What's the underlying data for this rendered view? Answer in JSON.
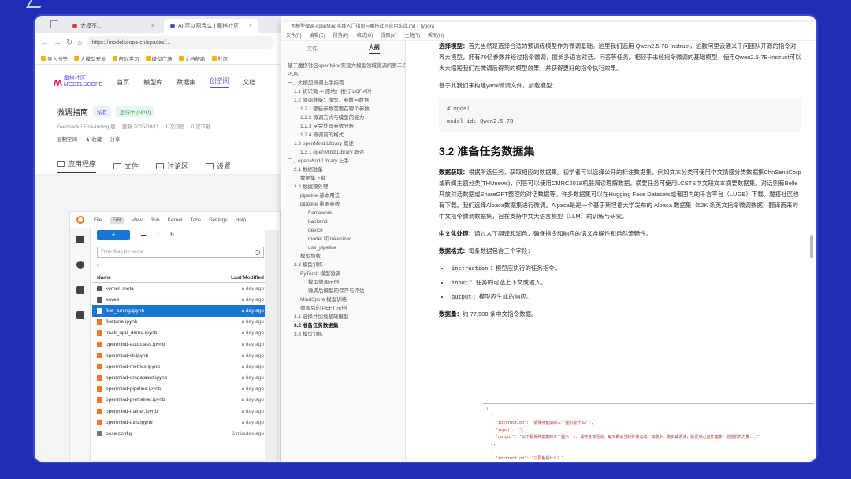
{
  "browser": {
    "tabs": [
      {
        "label": "大模不..."
      },
      {
        "label": "AI 可以帮我么 | 魔搭社区"
      }
    ],
    "url": "https://modelscope.cn/spaces/...",
    "bookmarks": [
      "导入书签",
      "大模型开发",
      "帮你学习",
      "模型广场",
      "文档帮助",
      "社区",
      "开发者"
    ],
    "site": {
      "logo_text": "魔搭社区\nMODELSCOPE",
      "nav": [
        "首页",
        "模型库",
        "数据集",
        "创空间",
        "文档"
      ],
      "active_nav": "创空间"
    },
    "space": {
      "title": "微调指南",
      "tag": "私有",
      "status": "运行中 (NPU)",
      "meta": [
        "Feedback / Fine-tuning 版",
        "更新 2025/09/11",
        "1 次浏览",
        "0 次下载"
      ],
      "actions": [
        "复制空间",
        "★ 收藏",
        "分享"
      ],
      "tabs": [
        "应用程序",
        "文件",
        "讨论区",
        "设置"
      ],
      "active_tab": "应用程序"
    },
    "jupyter": {
      "menu": [
        "File",
        "Edit",
        "View",
        "Run",
        "Kernel",
        "Tabs",
        "Settings",
        "Help"
      ],
      "active_menu": "Edit",
      "filter_placeholder": "Filter files by name",
      "crumb": "/",
      "col_name": "Name",
      "col_modified": "Last Modified",
      "files": [
        {
          "name": "kernel_meta",
          "type": "folder",
          "modified": "a day ago"
        },
        {
          "name": "saves",
          "type": "folder",
          "modified": "a day ago"
        },
        {
          "name": "fine_tuning.ipynb",
          "type": "nb",
          "modified": "a day ago",
          "selected": true
        },
        {
          "name": "finetune.ipynb",
          "type": "nb",
          "modified": "a day ago"
        },
        {
          "name": "multi_npu_demo.ipynb",
          "type": "nb",
          "modified": "a day ago"
        },
        {
          "name": "openmind-autoclass.ipynb",
          "type": "nb",
          "modified": "a day ago"
        },
        {
          "name": "openmind-cli.ipynb",
          "type": "nb",
          "modified": "a day ago"
        },
        {
          "name": "openmind-metrics.ipynb",
          "type": "nb",
          "modified": "a day ago"
        },
        {
          "name": "openmind-omdataset.ipynb",
          "type": "nb",
          "modified": "a day ago"
        },
        {
          "name": "openmind-pipeline.ipynb",
          "type": "nb",
          "modified": "a day ago"
        },
        {
          "name": "openmind-pretrainer.ipynb",
          "type": "nb",
          "modified": "a day ago"
        },
        {
          "name": "openmind-trainer.ipynb",
          "type": "nb",
          "modified": "a day ago"
        },
        {
          "name": "openmind-utils.ipynb",
          "type": "nb",
          "modified": "a day ago"
        },
        {
          "name": "pose.config",
          "type": "file",
          "modified": "3 minutes ago"
        }
      ]
    }
  },
  "typora": {
    "title": "大模型微调-openMind实践入门指南与魔搭社区应用实战.md - Typora",
    "menu": [
      "文件(F)",
      "编辑(E)",
      "段落(P)",
      "格式(O)",
      "视图(V)",
      "主题(T)",
      "帮助(H)"
    ],
    "side_tabs": [
      "文件",
      "大纲"
    ],
    "active_side_tab": "大纲",
    "outline": [
      {
        "text": "基于魔搭社区openMind实现大模型领域微调的第二次模型重新实操",
        "level": 0
      },
      {
        "text": "PUA",
        "level": 0
      },
      {
        "text": "一、大模型微调上手指南",
        "level": 0
      },
      {
        "text": "1.1 初识微 -> 原地：推行 LORA时",
        "level": 1
      },
      {
        "text": "1.2 微调准备：模型、参数与数据",
        "level": 1
      },
      {
        "text": "1.2.1 哪些参数需要在哪个参数",
        "level": 2
      },
      {
        "text": "1.2.2 微调方式与模型的能力",
        "level": 2
      },
      {
        "text": "1.2.3 学会处理参数分析",
        "level": 2
      },
      {
        "text": "1.2.4 微调前的格式",
        "level": 2
      },
      {
        "text": "1.3 openMind Library 概述",
        "level": 1
      },
      {
        "text": "1.3.1 openMind Library 概述",
        "level": 2
      },
      {
        "text": "二、openMind Library 上手",
        "level": 0
      },
      {
        "text": "2.1 数据准备",
        "level": 1
      },
      {
        "text": "数据集下载",
        "level": 2
      },
      {
        "text": "2.2 数据预处理",
        "level": 1
      },
      {
        "text": "pipeline 基本用法",
        "level": 2
      },
      {
        "text": "pipeline 重要参数",
        "level": 2
      },
      {
        "text": "framework",
        "level": 3
      },
      {
        "text": "backend",
        "level": 3
      },
      {
        "text": "device",
        "level": 3
      },
      {
        "text": "model 和 tokenizer",
        "level": 3
      },
      {
        "text": "use_pipeline",
        "level": 3
      },
      {
        "text": "模型加载",
        "level": 2
      },
      {
        "text": "2.3 模型训练",
        "level": 1
      },
      {
        "text": "PyTorch 模型微调",
        "level": 2
      },
      {
        "text": "模型微调示例",
        "level": 3
      },
      {
        "text": "微调后模型的保存与评估",
        "level": 3
      },
      {
        "text": "MindSpore 模型训练",
        "level": 2
      },
      {
        "text": "微调后的 PEFT 示例",
        "level": 2
      },
      {
        "text": "3.1 选择并加载基础模型",
        "level": 1
      },
      {
        "text": "3.2 准备任务数据集",
        "level": 1,
        "current": true
      },
      {
        "text": "3.3 模型训练",
        "level": 1
      }
    ],
    "doc": {
      "p1_label": "选择模型：",
      "p1": "首先当然是选择合适的预训练模型作为微调基础。这里我们选用 Qwen2.5-7B-Instruct，这款阿里云通义千问团队开源的指令对齐大模型，拥有70亿参数并经过指令微调，擅长多语言对话、问答等任务。相较于未经指令微调的基础模型，使用Qwen2.5-7B-Instruct可以大大缩短我们在微调后得到的模型效果，并获得更好的指令执行效果。",
      "p2": "基于此我们来构建yaml微调文件，加载模型：",
      "code_comment": "# model",
      "code_line": "model_id: Qwen2.5-7B",
      "h2": "3.2 准备任务数据集",
      "p3_label": "数据获取：",
      "p3": "根据所选任务，获取相应的数据集。初学者可以选择公开的标注数据集，例如文本分类可使用中文情感分类数据集ChnSentiCorp或新闻主题分类(THUnews)，问答可以使用CMRC2018机器阅读理解数据，摘要任务可使用LCSTS中文短文本摘要数据集。对话则有Belle开放对话数据或ShareGPT整理的对话数据等。许多数据集可以在Hugging Face Datasets或者国内的千言平台（LUGE）下载。魔搭社区也有下载。我们选择Alpaca数据集进行微调。Alpaca是是一个基于斯坦福大学发布的 Alpaca 数据集（52K 条英文指令微调数据）翻译而来的中文指令微调数据集，旨在支持中文大语言模型（LLM）的训练与研究。",
      "p4_label": "中文化处理：",
      "p4": "通过人工翻译和润色，确保指令和响应的语义准确性和自然流畅性。",
      "p5_label": "数据格式：",
      "p5": "每条数据包含三个字段：",
      "fields": [
        {
          "key": "instruction",
          "desc": "：模型应执行的任务指令。"
        },
        {
          "key": "input",
          "desc": "：任务的可选上下文或输入。"
        },
        {
          "key": "output",
          "desc": "：模型应生成的响应。"
        }
      ],
      "p6_label": "数据量：",
      "p6": "约 77,500 条中文指令数据。"
    },
    "json_lines": [
      "[",
      "  {",
      "    \"instruction\": \"请保持健康的三个提示是什么？\",",
      "    \"input\": \"\",",
      "    \"output\": \"以下是保持健康的三个提示：1. 保持身体活动。每天做适当的身体运动，如散步、跑步或游泳，能促进心血管健康，增强肌肉力量...\"",
      "  },",
      "  {",
      "    \"instruction\": \"三原色是什么？\",",
      "    \"input\": \"\",",
      "    \"output\": \"三原色通常指的是红色、绿色和蓝色（RGB）。它们是通过加色混合原理创建色彩的三种基础颜色...\"",
      "  },",
      "  {",
      "    \"instruction\": \"描述原子的结构。\","
    ]
  }
}
